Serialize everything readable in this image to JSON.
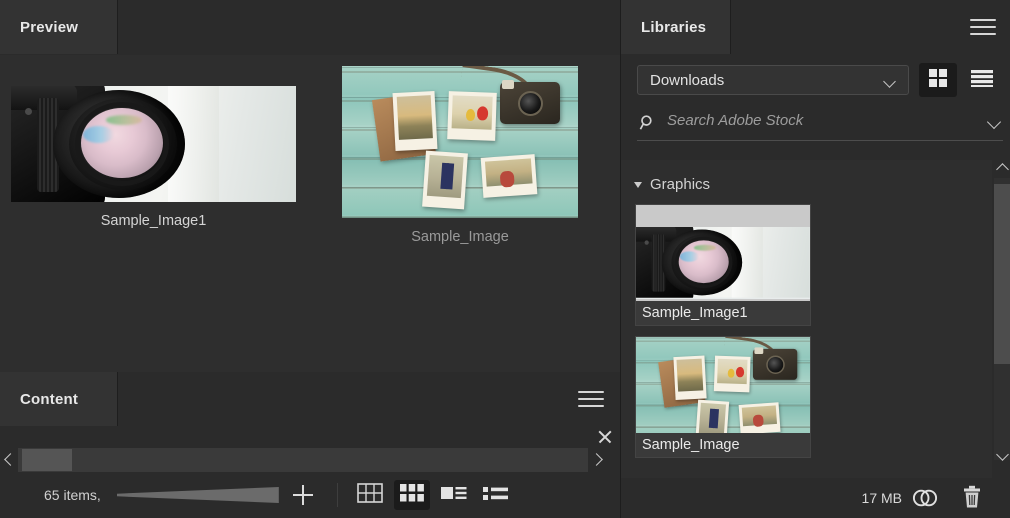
{
  "preview_panel": {
    "tab_label": "Preview",
    "items": [
      {
        "caption": "Sample_Image1",
        "thumb": "camera-lens-photo"
      },
      {
        "caption": "Sample_Image",
        "thumb": "polaroids-on-wood-photo"
      }
    ]
  },
  "content_panel": {
    "tab_label": "Content",
    "menu_icon": "hamburger-icon",
    "close_icon": "close-icon",
    "scroll_left_icon": "chevron-left-icon",
    "scroll_right_icon": "chevron-right-icon",
    "status": {
      "items_count": "65 items,",
      "slider_name": "thumbnail-size-slider",
      "plus_icon": "plus-icon"
    },
    "view_buttons": [
      {
        "name": "grid-outline-view",
        "icon": "grid-outline-icon",
        "selected": false
      },
      {
        "name": "thumbnail-grid-view",
        "icon": "grid-filled-icon",
        "selected": true
      },
      {
        "name": "details-view",
        "icon": "details-icon",
        "selected": false
      },
      {
        "name": "list-view",
        "icon": "list-icon",
        "selected": false
      }
    ]
  },
  "libraries_panel": {
    "tab_label": "Libraries",
    "menu_icon": "hamburger-icon",
    "library_select": {
      "value": "Downloads",
      "chevron_icon": "chevron-down-icon"
    },
    "view_buttons": [
      {
        "name": "library-grid-view",
        "icon": "grid-icon",
        "selected": true
      },
      {
        "name": "library-list-view",
        "icon": "list-icon",
        "selected": false
      }
    ],
    "search": {
      "placeholder": "Search Adobe Stock",
      "icon": "search-icon",
      "chevron_icon": "chevron-down-icon"
    },
    "groups": [
      {
        "label": "Graphics",
        "expanded": true,
        "disclosure_icon": "triangle-down-icon",
        "assets": [
          {
            "name": "Sample_Image1",
            "thumb": "camera-lens-photo"
          },
          {
            "name": "Sample_Image",
            "thumb": "polaroids-on-wood-photo"
          }
        ]
      }
    ],
    "scrollbar": {
      "up_icon": "chevron-up-icon",
      "down_icon": "chevron-down-icon"
    },
    "footer": {
      "size_label": "17 MB",
      "cloud_icon": "creative-cloud-icon",
      "delete_icon": "trash-icon"
    }
  },
  "colors": {
    "panel_bg": "#2b2b2b",
    "body_bg": "#2e2e2e",
    "tab_active_bg": "#333333",
    "text": "#d4d4d4",
    "selected_bg": "#1b1b1b"
  }
}
